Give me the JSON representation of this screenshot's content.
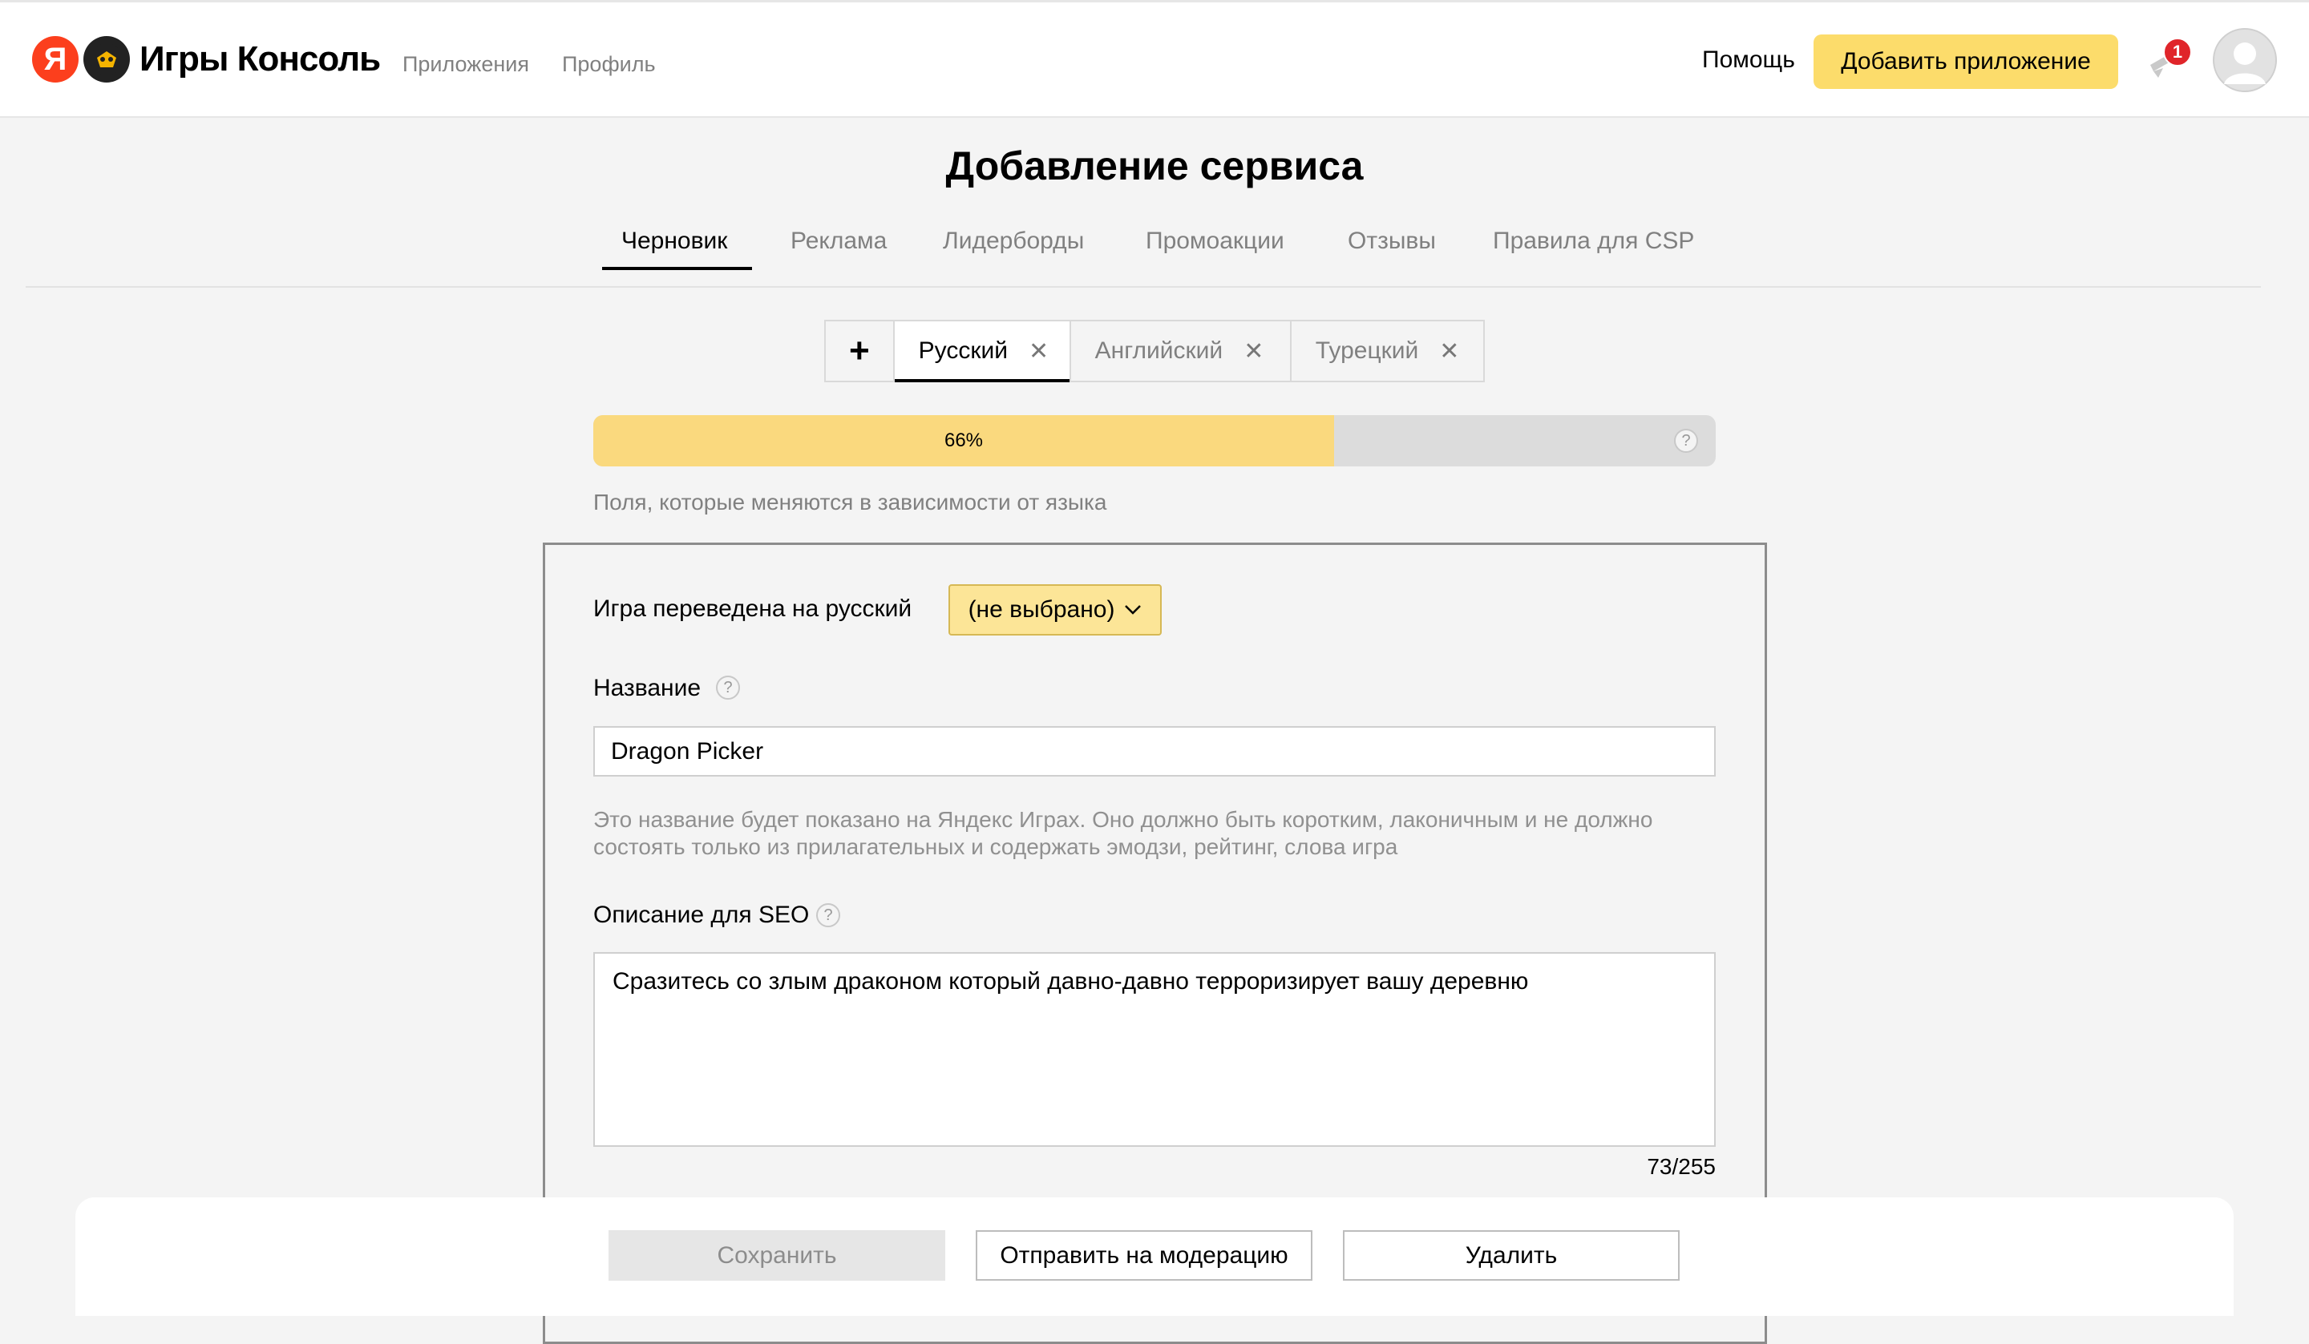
{
  "header": {
    "logo_letter": "Я",
    "brand": "Игры Консоль",
    "nav": [
      "Приложения",
      "Профиль"
    ],
    "help": "Помощь",
    "add_app": "Добавить приложение",
    "notification_count": "1"
  },
  "page": {
    "title": "Добавление сервиса",
    "tabs": [
      {
        "label": "Черновик",
        "active": true
      },
      {
        "label": "Реклама"
      },
      {
        "label": "Лидерборды"
      },
      {
        "label": "Промоакции"
      },
      {
        "label": "Отзывы"
      },
      {
        "label": "Правила для CSP"
      }
    ]
  },
  "languages": {
    "add": "+",
    "items": [
      {
        "label": "Русский",
        "active": true
      },
      {
        "label": "Английский"
      },
      {
        "label": "Турецкий"
      }
    ],
    "close_glyph": "✕"
  },
  "progress": {
    "value_percent": 66,
    "label": "66%"
  },
  "form": {
    "section_hint": "Поля, которые меняются в зависимости от языка",
    "translated_label": "Игра переведена на русский",
    "translated_value": "(не выбрано)",
    "name_label": "Название",
    "name_value": "Dragon Picker",
    "name_hint": "Это название будет показано на Яндекс Играх. Оно должно быть коротким, лаконичным и не должно состоять только из прилагательных и содержать эмодзи, рейтинг, слова игра",
    "seo_label": "Описание для SEO",
    "seo_value": "Сразитесь со злым драконом который давно-давно терроризирует вашу деревню",
    "seo_counter": "73/255",
    "help_glyph": "?"
  },
  "actions": {
    "save": "Сохранить",
    "moderate": "Отправить на модерацию",
    "delete": "Удалить"
  },
  "colors": {
    "accent_yellow": "#fcdc6b",
    "progress_fill": "#fad97e",
    "badge_red": "#e0252a",
    "logo_red": "#fc3f1d"
  }
}
